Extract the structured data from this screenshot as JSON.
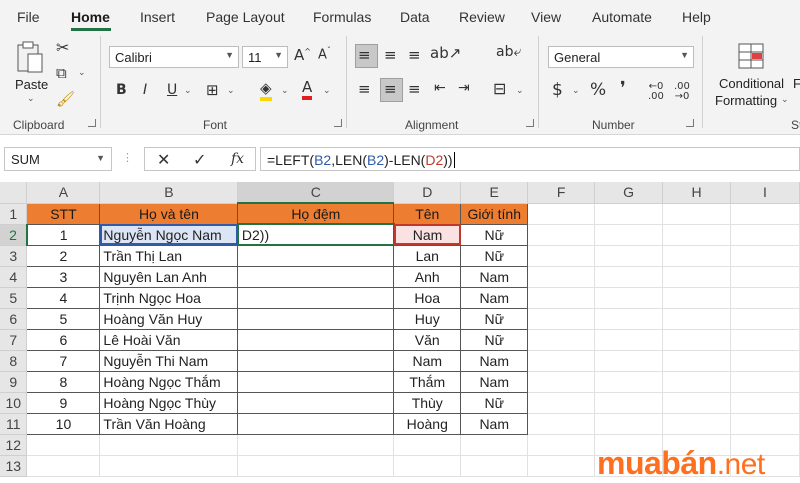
{
  "menu": [
    "File",
    "Home",
    "Insert",
    "Page Layout",
    "Formulas",
    "Data",
    "Review",
    "View",
    "Automate",
    "Help"
  ],
  "ribbon": {
    "clipboard_label": "Clipboard",
    "paste_label": "Paste",
    "font_label": "Font",
    "font_name": "Calibri",
    "font_size": "11",
    "alignment_label": "Alignment",
    "number_label": "Number",
    "number_format": "General",
    "conditional_label": "Conditional",
    "formatting_label": "Formatting",
    "styles_partial": "St",
    "partial_f": "F"
  },
  "formula_bar": {
    "name_box": "SUM",
    "fx": "fx",
    "formula_parts": [
      "=LEFT(",
      "B2",
      ",LEN(",
      "B2",
      ")-LEN(",
      "D2",
      "))"
    ]
  },
  "sheet": {
    "columns": [
      "A",
      "B",
      "C",
      "D",
      "E",
      "F",
      "G",
      "H",
      "I"
    ],
    "rows": [
      "1",
      "2",
      "3",
      "4",
      "5",
      "6",
      "7",
      "8",
      "9",
      "10",
      "11",
      "12",
      "13"
    ],
    "header": [
      "STT",
      "Họ và tên",
      "Họ đệm",
      "Tên",
      "Giới tính"
    ],
    "editing_text": "D2))",
    "data": [
      [
        "1",
        "Nguyễn Ngọc Nam",
        "",
        "Nam",
        "Nữ"
      ],
      [
        "2",
        "Trần Thị Lan",
        "",
        "Lan",
        "Nữ"
      ],
      [
        "3",
        "Nguyên Lan Anh",
        "",
        "Anh",
        "Nam"
      ],
      [
        "4",
        "Trịnh Ngọc Hoa",
        "",
        "Hoa",
        "Nam"
      ],
      [
        "5",
        "Hoàng Văn Huy",
        "",
        "Huy",
        "Nữ"
      ],
      [
        "6",
        "Lê Hoài Văn",
        "",
        "Văn",
        "Nữ"
      ],
      [
        "7",
        "Nguyễn Thi Nam",
        "",
        "Nam",
        "Nam"
      ],
      [
        "8",
        "Hoàng Ngọc Thắm",
        "",
        "Thắm",
        "Nam"
      ],
      [
        "9",
        "Hoàng Ngọc Thùy",
        "",
        "Thùy",
        "Nữ"
      ],
      [
        "10",
        "Trần Văn Hoàng",
        "",
        "Hoàng",
        "Nam"
      ]
    ]
  },
  "watermark": {
    "brand": "muabán",
    "tld": ".net"
  },
  "colors": {
    "accent": "#217346",
    "header_fill": "#ed7d31",
    "ref_b": "#2f5ba8",
    "ref_d": "#c0392b",
    "watermark": "#ff6f20"
  }
}
